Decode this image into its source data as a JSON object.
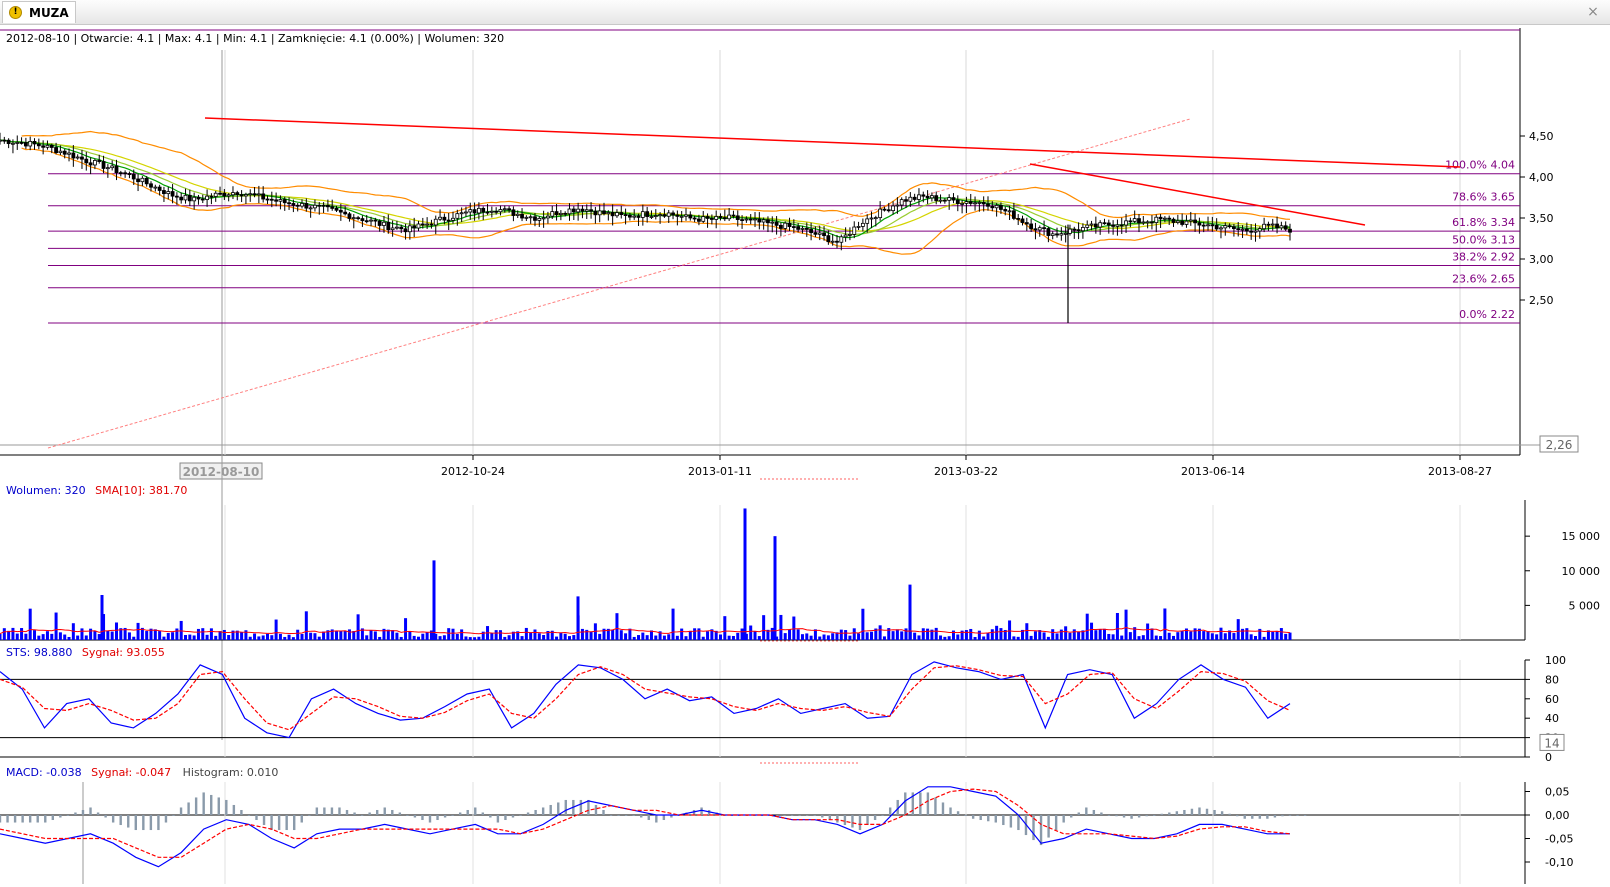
{
  "window": {
    "tab_label": "MUZA",
    "close_glyph": "×",
    "icon": "warning-icon"
  },
  "info_bar": {
    "date": "2012-08-10",
    "open_label": "Otwarcie",
    "open": "4.1",
    "max_label": "Max",
    "max": "4.1",
    "min_label": "Min",
    "min": "4.1",
    "close_label": "Zamknięcie",
    "close": "4.1 (0.00%)",
    "volume_label": "Wolumen",
    "volume": "320"
  },
  "colors": {
    "candle": "#000000",
    "band": "#ff8c00",
    "ma_green": "#00a000",
    "ma_lime": "#9acd32",
    "ma_yellow": "#d4d400",
    "fib": "#800080",
    "trend": "#ff0000",
    "volume": "#0000ff",
    "sma": "#ff0000",
    "sts": "#0000ff",
    "signal": "#ff0000",
    "histogram": "#8a9aaa"
  },
  "chart_data": [
    {
      "type": "candlestick",
      "title": "",
      "x_ticks": [
        "2012-10-24",
        "2013-01-11",
        "2013-03-22",
        "2013-06-14",
        "2013-08-27"
      ],
      "cursor_date": "2012-08-10",
      "y_ticks": [
        "4,50",
        "4,00",
        "3,50",
        "3,00",
        "2,50"
      ],
      "ylim": [
        2.2,
        4.7
      ],
      "last_price_label": "2,26",
      "fibonacci": [
        {
          "label": "100.0% 4.04",
          "value": 4.04
        },
        {
          "label": "78.6% 3.65",
          "value": 3.65
        },
        {
          "label": "61.8% 3.34",
          "value": 3.34
        },
        {
          "label": "50.0% 3.13",
          "value": 3.13
        },
        {
          "label": "38.2% 2.92",
          "value": 2.92
        },
        {
          "label": "23.6% 2.65",
          "value": 2.65
        },
        {
          "label": "0.0% 2.22",
          "value": 2.22
        }
      ],
      "price_path": [
        4.45,
        4.42,
        4.38,
        4.3,
        4.2,
        4.12,
        4.02,
        3.9,
        3.78,
        3.72,
        3.78,
        3.82,
        3.76,
        3.7,
        3.66,
        3.62,
        3.55,
        3.48,
        3.4,
        3.36,
        3.44,
        3.52,
        3.58,
        3.62,
        3.55,
        3.5,
        3.58,
        3.62,
        3.56,
        3.52,
        3.55,
        3.56,
        3.5,
        3.48,
        3.5,
        3.46,
        3.42,
        3.38,
        3.3,
        3.2,
        3.44,
        3.58,
        3.72,
        3.76,
        3.72,
        3.7,
        3.68,
        3.55,
        3.4,
        3.3,
        3.36,
        3.4,
        3.44,
        3.46,
        3.48,
        3.45,
        3.42,
        3.38,
        3.35,
        3.4,
        3.36
      ]
    },
    {
      "type": "bar",
      "title": "",
      "legend": [
        {
          "name": "Wolumen: 320"
        },
        {
          "name": "SMA[10]: 381.70"
        }
      ],
      "y_ticks": [
        "15 000",
        "10 000",
        "5 000"
      ],
      "ylim": [
        0,
        19500
      ],
      "spikes": [
        {
          "x": "2012-09-14",
          "value": 6500
        },
        {
          "x": "2012-10-10",
          "value": 11500
        },
        {
          "x": "2012-11-22",
          "value": 6300
        },
        {
          "x": "2013-01-03",
          "value": 19000
        },
        {
          "x": "2013-01-11",
          "value": 15000
        },
        {
          "x": "2013-02-27",
          "value": 8000
        }
      ]
    },
    {
      "type": "line",
      "title": "",
      "legend": [
        {
          "name": "STS: 98.880"
        },
        {
          "name": "Sygnał: 93.055"
        }
      ],
      "y_ticks": [
        "100",
        "80",
        "60",
        "40",
        "20",
        "0"
      ],
      "ylim": [
        0,
        100
      ],
      "levels": [
        20,
        80
      ],
      "last_value_label": "14",
      "series": [
        {
          "name": "STS",
          "values": [
            88,
            70,
            30,
            55,
            60,
            35,
            30,
            45,
            65,
            95,
            85,
            40,
            25,
            20,
            60,
            70,
            55,
            45,
            38,
            40,
            52,
            65,
            70,
            30,
            45,
            75,
            95,
            92,
            80,
            60,
            70,
            58,
            62,
            45,
            50,
            60,
            45,
            50,
            55,
            40,
            42,
            85,
            98,
            92,
            88,
            80,
            85,
            30,
            85,
            90,
            85,
            40,
            55,
            80,
            95,
            80,
            72,
            40,
            55
          ]
        },
        {
          "name": "Sygnał",
          "values": [
            80,
            72,
            50,
            48,
            55,
            48,
            38,
            40,
            55,
            85,
            88,
            60,
            35,
            28,
            45,
            62,
            60,
            52,
            42,
            40,
            46,
            58,
            65,
            45,
            40,
            60,
            85,
            93,
            85,
            70,
            66,
            62,
            60,
            52,
            48,
            55,
            50,
            48,
            52,
            46,
            42,
            70,
            92,
            94,
            90,
            84,
            83,
            55,
            65,
            85,
            87,
            60,
            50,
            68,
            88,
            86,
            78,
            58,
            48
          ]
        }
      ]
    },
    {
      "type": "line",
      "title": "",
      "legend": [
        {
          "name": "MACD: -0.038"
        },
        {
          "name": "Sygnał: -0.047"
        },
        {
          "name": "Histogram: 0.010"
        }
      ],
      "y_ticks": [
        "0,05",
        "0,00",
        "-0,05",
        "-0,10"
      ],
      "ylim": [
        -0.13,
        0.07
      ],
      "series": [
        {
          "name": "MACD",
          "values": [
            -0.04,
            -0.05,
            -0.06,
            -0.05,
            -0.04,
            -0.06,
            -0.09,
            -0.11,
            -0.08,
            -0.03,
            -0.01,
            -0.02,
            -0.05,
            -0.07,
            -0.04,
            -0.03,
            -0.03,
            -0.02,
            -0.03,
            -0.04,
            -0.03,
            -0.02,
            -0.04,
            -0.04,
            -0.02,
            0.01,
            0.03,
            0.02,
            0.01,
            0.0,
            0.0,
            0.01,
            0.0,
            0.0,
            0.0,
            -0.01,
            -0.01,
            -0.02,
            -0.04,
            -0.02,
            0.03,
            0.06,
            0.06,
            0.05,
            0.04,
            0.0,
            -0.06,
            -0.05,
            -0.03,
            -0.04,
            -0.05,
            -0.05,
            -0.04,
            -0.02,
            -0.02,
            -0.03,
            -0.04,
            -0.04
          ]
        },
        {
          "name": "Sygnał",
          "values": [
            -0.03,
            -0.04,
            -0.05,
            -0.05,
            -0.05,
            -0.05,
            -0.07,
            -0.09,
            -0.09,
            -0.06,
            -0.03,
            -0.02,
            -0.03,
            -0.05,
            -0.05,
            -0.04,
            -0.03,
            -0.03,
            -0.03,
            -0.03,
            -0.03,
            -0.03,
            -0.03,
            -0.04,
            -0.03,
            -0.01,
            0.01,
            0.02,
            0.01,
            0.01,
            0.0,
            0.0,
            0.0,
            0.0,
            0.0,
            -0.01,
            -0.01,
            -0.01,
            -0.02,
            -0.02,
            0.0,
            0.03,
            0.05,
            0.055,
            0.05,
            0.02,
            -0.02,
            -0.04,
            -0.04,
            -0.04,
            -0.045,
            -0.05,
            -0.045,
            -0.03,
            -0.025,
            -0.025,
            -0.035,
            -0.04
          ]
        }
      ]
    }
  ]
}
